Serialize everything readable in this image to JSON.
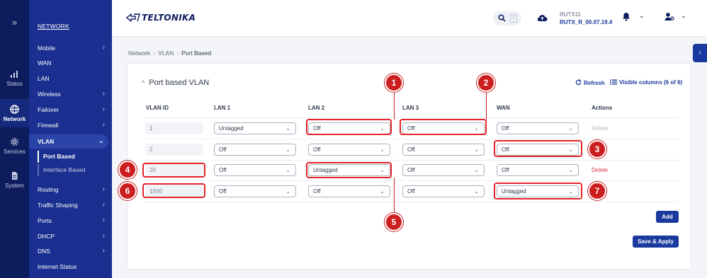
{
  "rail": {
    "expand": "»",
    "items": [
      {
        "label": "Status"
      },
      {
        "label": "Network"
      },
      {
        "label": "Services"
      },
      {
        "label": "System"
      }
    ]
  },
  "menu": {
    "title": "NETWORK",
    "items": [
      "Mobile",
      "WAN",
      "LAN",
      "Wireless",
      "Failover",
      "Firewall",
      "VLAN",
      "Routing",
      "Traffic Shaping",
      "Ports",
      "DHCP",
      "DNS",
      "Internet Status"
    ],
    "vlan_sub": [
      "Port Based",
      "Interface Based"
    ]
  },
  "header": {
    "logo": "TELTONIKA",
    "search_hint": "/",
    "device_name": "RUTX11",
    "firmware": "RUTX_R_00.07.19.4"
  },
  "breadcrumb": [
    "Network",
    "VLAN",
    "Port Based"
  ],
  "card": {
    "title": "Port based VLAN",
    "refresh": "Refresh",
    "visible_columns": "Visible columns (6 of 6)",
    "columns": [
      "VLAN ID",
      "LAN 1",
      "LAN 2",
      "LAN 3",
      "WAN",
      "Actions"
    ],
    "rows": [
      {
        "id": "1",
        "lan1": "Untagged",
        "lan2": "Off",
        "lan3": "Off",
        "wan": "Off",
        "action": "Delete"
      },
      {
        "id": "2",
        "lan1": "Off",
        "lan2": "Off",
        "lan3": "Off",
        "wan": "Off",
        "action": ""
      },
      {
        "id": "20",
        "lan1": "Off",
        "lan2": "Untagged",
        "lan3": "Off",
        "wan": "Off",
        "action": "Delete"
      },
      {
        "id": "1500",
        "lan1": "Off",
        "lan2": "Off",
        "lan3": "Off",
        "wan": "Untagged",
        "action": ""
      }
    ],
    "add": "Add",
    "save_apply": "Save & Apply"
  },
  "annotations": [
    "1",
    "2",
    "3",
    "4",
    "5",
    "6",
    "7"
  ],
  "colors": {
    "nav_dark": "#0d1c5c",
    "nav_panel": "#1a2f8f",
    "accent": "#1a3a9f",
    "annotation": "#cc1e1e",
    "delete": "#e2343f"
  }
}
